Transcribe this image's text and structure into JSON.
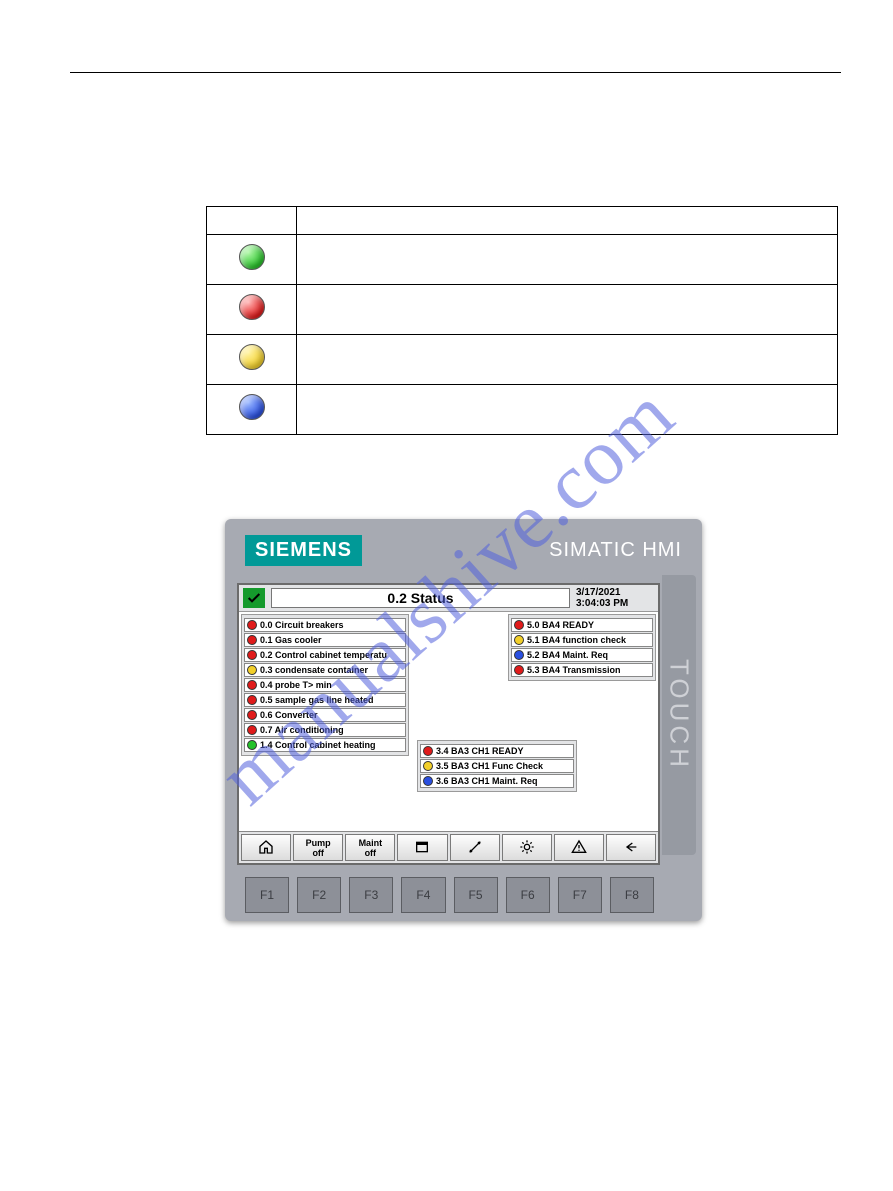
{
  "watermark": "manualshive.com",
  "legend": {
    "rows": [
      {
        "dot_class": "dot-green",
        "name": "status-green"
      },
      {
        "dot_class": "dot-red",
        "name": "status-red"
      },
      {
        "dot_class": "dot-yellow",
        "name": "status-yellow"
      },
      {
        "dot_class": "dot-blue",
        "name": "status-blue"
      }
    ]
  },
  "hmi": {
    "brand": "SIEMENS",
    "model": "SIMATIC HMI",
    "side_label": "TOUCH",
    "title": "0.2 Status",
    "date": "3/17/2021",
    "time": "3:04:03 PM",
    "panels": {
      "left": [
        {
          "led": "led-red",
          "label": "0.0 Circuit breakers"
        },
        {
          "led": "led-red",
          "label": "0.1 Gas cooler"
        },
        {
          "led": "led-red",
          "label": "0.2 Control cabinet temperatu"
        },
        {
          "led": "led-yellow",
          "label": "0.3 condensate container"
        },
        {
          "led": "led-red",
          "label": "0.4 probe T> min"
        },
        {
          "led": "led-red",
          "label": "0.5 sample gas line heated"
        },
        {
          "led": "led-red",
          "label": "0.6 Converter"
        },
        {
          "led": "led-red",
          "label": "0.7 Air conditioning"
        },
        {
          "led": "led-green",
          "label": "1.4 Control cabinet heating"
        }
      ],
      "right": [
        {
          "led": "led-red",
          "label": "5.0 BA4 READY"
        },
        {
          "led": "led-yellow",
          "label": "5.1 BA4 function check"
        },
        {
          "led": "led-blue",
          "label": "5.2 BA4 Maint. Req"
        },
        {
          "led": "led-red",
          "label": "5.3 BA4 Transmission"
        }
      ],
      "mid": [
        {
          "led": "led-red",
          "label": "3.4 BA3 CH1 READY"
        },
        {
          "led": "led-yellow",
          "label": "3.5 BA3 CH1 Func Check"
        },
        {
          "led": "led-blue",
          "label": "3.6 BA3 CH1 Maint. Req"
        }
      ]
    },
    "softkeys": [
      {
        "name": "home-button",
        "icon": "home",
        "label1": "",
        "label2": ""
      },
      {
        "name": "pump-off-button",
        "icon": "",
        "label1": "Pump",
        "label2": "off"
      },
      {
        "name": "maint-off-button",
        "icon": "",
        "label1": "Maint",
        "label2": "off"
      },
      {
        "name": "window-button",
        "icon": "window",
        "label1": "",
        "label2": ""
      },
      {
        "name": "tools-button",
        "icon": "tools",
        "label1": "",
        "label2": ""
      },
      {
        "name": "settings-button",
        "icon": "gear",
        "label1": "",
        "label2": ""
      },
      {
        "name": "alarm-button",
        "icon": "warn",
        "label1": "",
        "label2": ""
      },
      {
        "name": "back-button",
        "icon": "back",
        "label1": "",
        "label2": ""
      }
    ],
    "fkeys": [
      "F1",
      "F2",
      "F3",
      "F4",
      "F5",
      "F6",
      "F7",
      "F8"
    ]
  }
}
